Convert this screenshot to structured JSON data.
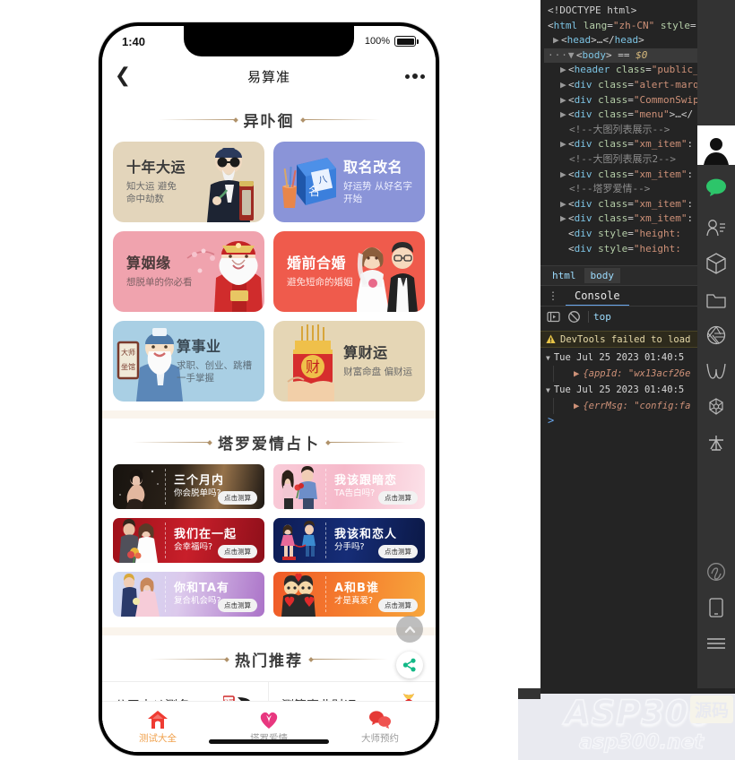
{
  "simulator": {
    "status_bar": {
      "time": "1:40",
      "battery_pct": "100%"
    },
    "nav": {
      "back_icon": "chevron-left-icon",
      "title": "易算准",
      "more_icon": "more-horizontal-icon"
    },
    "sections": [
      {
        "title": "异卟徊",
        "cards": [
          {
            "title": "十年大运",
            "subtitle": "知大运 避免\n命中劫数",
            "bg": "#e3d5bb",
            "title_color": "#3b3b3b",
            "sub_color": "#6a6a6a",
            "art": "fortune-teller-art",
            "layout": "text-left"
          },
          {
            "title": "取名改名",
            "subtitle": "好运势 从好名字\n开始",
            "bg": "#8a94d8",
            "title_color": "#ffffff",
            "sub_color": "#f0f0ff",
            "art": "naming-book-art",
            "layout": "text-right"
          },
          {
            "title": "算姻缘",
            "subtitle": "想脱单的你必看",
            "bg": "#f0a3ae",
            "title_color": "#4a3a3a",
            "sub_color": "#7a5f62",
            "art": "match-god-art",
            "layout": "text-left"
          },
          {
            "title": "婚前合婚",
            "subtitle": "避免短命的婚姻",
            "bg": "#ef5b4c",
            "title_color": "#ffffff",
            "sub_color": "#ffe5e2",
            "art": "wedding-couple-art",
            "layout": "text-left"
          },
          {
            "title": "算事业",
            "subtitle": "求职、创业、跳槽\n一手掌握",
            "bg": "#a9cfe4",
            "title_color": "#3b4a55",
            "sub_color": "#5a6a75",
            "art": "career-sage-art",
            "layout": "text-right"
          },
          {
            "title": "算财运",
            "subtitle": "财富命盘 偏财运",
            "bg": "#e5d6b5",
            "title_color": "#3b3b3b",
            "sub_color": "#6a6a6a",
            "art": "money-can-art",
            "layout": "text-right"
          }
        ]
      }
    ],
    "tarot": {
      "title": "塔罗爱情占卜",
      "button_label": "点击测算",
      "cards": [
        {
          "line1": "三个月内",
          "line2": "你会脱单吗?",
          "bg": "linear-gradient(100deg,#17130f 0%,#2a2118 45%,#8a6a42 72%,#1c1713 100%)",
          "art": "lonely-woman-art"
        },
        {
          "line1": "我该跟暗恋",
          "line2": "TA告白吗?",
          "bg": "linear-gradient(100deg,#f7c5d3 0%,#f6b9ca 45%,#fadfe6 100%)",
          "art": "shy-couple-art"
        },
        {
          "line1": "我们在一起",
          "line2": "会幸福吗?",
          "bg": "linear-gradient(100deg,#a31320 0%,#c81f2a 50%,#8e0f1a 100%)",
          "art": "bride-groom-art"
        },
        {
          "line1": "我该和恋人",
          "line2": "分手吗?",
          "bg": "linear-gradient(100deg,#0e1f5c 0%,#162d77 50%,#0b1845 100%)",
          "art": "breakup-art"
        },
        {
          "line1": "你和TA有",
          "line2": "复合机会吗?",
          "bg": "linear-gradient(100deg,#c9d9f2 0%,#d9c7ea 45%,#b57fd0 100%)",
          "art": "reunion-art"
        },
        {
          "line1": "A和B谁",
          "line2": "才是真爱?",
          "bg": "linear-gradient(100deg,#f05a2a 0%,#f5812f 55%,#f7a13a 100%)",
          "art": "two-lovers-art"
        }
      ]
    },
    "hot": {
      "title": "热门推荐",
      "items": [
        {
          "label": "公司吉凶测名",
          "icon": "seal-brush-icon"
        },
        {
          "label": "测算事业财运",
          "icon": "money-bag-icon"
        }
      ]
    },
    "floats": [
      {
        "name": "scroll-to-top-button",
        "icon": "chevron-up-icon"
      },
      {
        "name": "share-button",
        "icon": "share-nodes-icon"
      }
    ],
    "tabbar": {
      "active_color": "#f0a04b",
      "inactive_color": "#9a9a9a",
      "items": [
        {
          "label": "测试大全",
          "icon": "home-icon",
          "active": true
        },
        {
          "label": "塔罗爱情",
          "icon": "heart-tarot-icon",
          "active": false
        },
        {
          "label": "大师预约",
          "icon": "wechat-bubbles-icon",
          "active": false
        }
      ]
    }
  },
  "devtools": {
    "dom": [
      {
        "indent": 0,
        "tri": "",
        "kind": "doctype",
        "text": "<!DOCTYPE html>"
      },
      {
        "indent": 0,
        "tri": "",
        "kind": "open",
        "tag": "html",
        "attr": "lang",
        "val": "\"zh-CN\"",
        "tail": " style=\"font-"
      },
      {
        "indent": 1,
        "tri": "▶",
        "kind": "collapsed",
        "text": "<head>…</head>"
      },
      {
        "indent": 1,
        "tri": "▼",
        "kind": "selected",
        "text": "<body>",
        "eq": "== $0"
      },
      {
        "indent": 2,
        "tri": "▶",
        "kind": "open",
        "tag": "header",
        "attr": "class",
        "val": "\"public_heade",
        "tail": ""
      },
      {
        "indent": 2,
        "tri": "▶",
        "kind": "open",
        "tag": "div",
        "attr": "class",
        "val": "\"alert-marquee\"",
        "tail": " "
      },
      {
        "indent": 2,
        "tri": "▶",
        "kind": "open",
        "tag": "div",
        "attr": "class",
        "val": "\"CommonSwiper\"",
        "tail": ">…"
      },
      {
        "indent": 2,
        "tri": "▶",
        "kind": "open",
        "tag": "div",
        "attr": "class",
        "val": "\"menu\"",
        "tail": ">…</"
      },
      {
        "indent": 3,
        "tri": "",
        "kind": "comment",
        "text": "<!--大图列表展示-->"
      },
      {
        "indent": 2,
        "tri": "▶",
        "kind": "open",
        "tag": "div",
        "attr": "class",
        "val": "\"xm_item\"",
        "tail": ":"
      },
      {
        "indent": 3,
        "tri": "",
        "kind": "comment",
        "text": "<!--大图列表展示2-->"
      },
      {
        "indent": 2,
        "tri": "▶",
        "kind": "open",
        "tag": "div",
        "attr": "class",
        "val": "\"xm_item\"",
        "tail": ":"
      },
      {
        "indent": 3,
        "tri": "",
        "kind": "comment",
        "text": "<!--塔罗爱情-->"
      },
      {
        "indent": 2,
        "tri": "▶",
        "kind": "open",
        "tag": "div",
        "attr": "class",
        "val": "\"xm_item\"",
        "tail": ":"
      },
      {
        "indent": 2,
        "tri": "▶",
        "kind": "open",
        "tag": "div",
        "attr": "class",
        "val": "\"xm_item\"",
        "tail": ":"
      },
      {
        "indent": 2,
        "tri": "",
        "kind": "open",
        "tag": "div",
        "attr": "style",
        "val": "\"height: ",
        "tail": ""
      },
      {
        "indent": 2,
        "tri": "",
        "kind": "open",
        "tag": "div",
        "attr": "style",
        "val": "\"height: ",
        "tail": ""
      }
    ],
    "breadcrumbs": [
      {
        "label": "html",
        "active": false
      },
      {
        "label": "body",
        "active": true
      }
    ],
    "console": {
      "tab_label": "Console",
      "kebab_icon": "kebab-menu-icon",
      "execute_icon": "eager-eval-icon",
      "clear_icon": "clear-console-icon",
      "context": "top",
      "warning": {
        "icon": "warning-triangle-icon",
        "text": "DevTools failed to load"
      },
      "logs": [
        {
          "head": "Tue Jul 25 2023 01:40:5",
          "obj": "{appId: \"wx13acf26e"
        },
        {
          "head": "Tue Jul 25 2023 01:40:5",
          "obj": "{errMsg: \"config:fa"
        }
      ],
      "prompt": ">"
    },
    "rail_icons": [
      "avatar-icon",
      "chat-bubble-icon",
      "contacts-icon",
      "cube-icon",
      "folder-icon",
      "aperture-icon",
      "wave-icon",
      "molecule-icon",
      "asterisk-icon",
      "miniprogram-icon",
      "mobile-icon",
      "menu-lines-icon"
    ]
  },
  "watermark": {
    "line1": "ASP300",
    "badge": "源码",
    "line2": "asp300.net"
  }
}
